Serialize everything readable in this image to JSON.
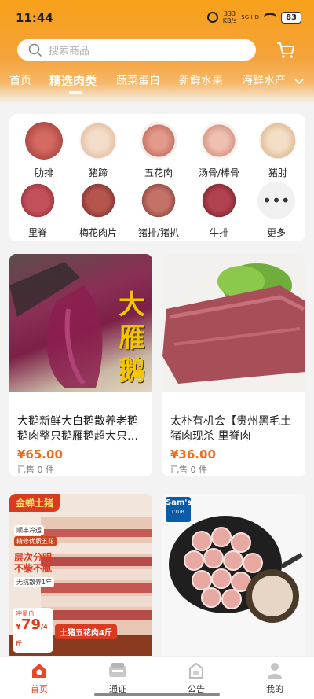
{
  "status_bar": {
    "time": "11:44",
    "speed_value": "333",
    "speed_unit": "KB/s",
    "network": "5G HD",
    "battery": "83"
  },
  "search": {
    "placeholder": "搜索商品"
  },
  "tabs": [
    {
      "label": "首页"
    },
    {
      "label": "精选肉类"
    },
    {
      "label": "蔬菜蛋白"
    },
    {
      "label": "新鲜水果"
    },
    {
      "label": "海鲜水产"
    }
  ],
  "categories": [
    {
      "label": "肋排",
      "color": "#c0584f"
    },
    {
      "label": "猪蹄",
      "color": "#f0d8c8"
    },
    {
      "label": "五花肉",
      "color": "#d88a7a"
    },
    {
      "label": "汤骨/棒骨",
      "color": "#e6b6a8"
    },
    {
      "label": "猪肘",
      "color": "#efd6bb"
    },
    {
      "label": "里脊",
      "color": "#b8474c"
    },
    {
      "label": "梅花肉片",
      "color": "#a34a44"
    },
    {
      "label": "猪排/猪扒",
      "color": "#b9665e"
    },
    {
      "label": "牛排",
      "color": "#9e3440"
    },
    {
      "label": "更多",
      "icon": "more-dots-icon"
    }
  ],
  "products": [
    {
      "title": "大鹅新鲜大白鹅散养老鹅鹅肉整只鹅雁鹅超大只…",
      "price": "¥65.00",
      "sold": "已售 0 件",
      "image_text": [
        "大",
        "雁",
        "鹅"
      ]
    },
    {
      "title": "太朴有机会【贵州黑毛土猪肉现杀 里脊肉",
      "price": "¥36.00",
      "sold": "已售 0 件"
    },
    {
      "badge": "金蝉土猪",
      "labels": [
        "顺丰冷运",
        "精修优质五花",
        "层次分明",
        "不柴不腻",
        "无抗散养1年"
      ],
      "promo": "冲量价",
      "promo_price": "79",
      "promo_unit": "/4斤",
      "banner": "土猪五花肉4斤"
    },
    {
      "brand": "Sam's",
      "brand_sub": "CLUB"
    }
  ],
  "bottom_nav": [
    {
      "label": "首页",
      "icon": "home-icon",
      "active": true
    },
    {
      "label": "通证",
      "icon": "token-icon"
    },
    {
      "label": "公告",
      "icon": "notice-icon"
    },
    {
      "label": "我的",
      "icon": "profile-icon"
    }
  ],
  "colors": {
    "accent": "#f26b1d",
    "header": "#f7a11a",
    "nav_active": "#e8472b"
  }
}
